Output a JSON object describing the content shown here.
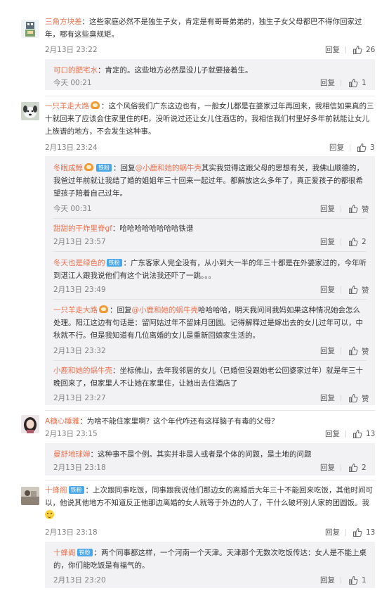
{
  "reply_label": "回复",
  "like_label_zero": "赞",
  "badge_label": "铁粉",
  "comments": [
    {
      "user": "三角方块差",
      "colon": "：",
      "text": "这些家庭必然不是独生子女，肯定是有哥哥弟弟的，独生子女父母都巴不得你回家过年，哪有这些臭规矩。",
      "time": "2月13日 23:22",
      "likes": "26"
    },
    {
      "user": "可口的肥宅水",
      "colon": "：",
      "text": "肯定的。这些地方必然是没儿子就要接着生。",
      "time": "今天 00:21",
      "likes": "1"
    },
    {
      "user": "一只羊走大路",
      "colon": "：",
      "text": "这个风俗我们广东这边也有，一般女儿都是在婆家过年再回来，我相信如果真的三十就回来了应该会住家里住的吧，没听说过还让女儿住酒店的，我相信我们村里好多年前就能让女儿上族谱的地方，不会发生这种事。",
      "time": "2月13日 23:24",
      "likes": "3"
    },
    {
      "user": "冬眠成鲸",
      "colon": "：",
      "reply_to": "回复",
      "mention": "@小鹿和她的蜗牛壳",
      "text": "其实我觉得这跟父母的思想有关，我佛山顺德的，我爸过年前就让我结了婚的姐姐年三十回来一起过年。都解放这么多年了，真正爱孩子的都很希望孩子陪着自己过年。",
      "time": "今天 00:31",
      "likes": "赞"
    },
    {
      "user": "甜甜的干炸里脊gf",
      "colon": "：",
      "text": "哈哈哈哈哈哈哈哈铁谱",
      "time": "2月13日 23:57",
      "likes": "2"
    },
    {
      "user": "冬天也是绿色的",
      "colon": "：",
      "text": "广东客家人完全没有，从小到大一半的年三十都是在外婆家过的，今年听到湛江人跟我说他们有这个说法我还吓了一跳。。。",
      "time": "2月13日 23:49",
      "likes": "赞"
    },
    {
      "user": "一只羊走大路",
      "colon": "：",
      "reply_to": "回复",
      "mention": "@小鹿和她的蜗牛壳",
      "text": "哈哈哈哈，明天我问问我妈如果这种情况她会怎么处理。阳江这边有句话是：留阿姑过年不留妹月团圆。记得解释过是嫁出去的女儿过年可以，中秋就不行。但是我知道有几位离婚的女儿是重新回娘家生活的。",
      "time": "2月13日 23:32",
      "likes": "赞"
    },
    {
      "user": "小鹿和她的蜗牛壳",
      "colon": "：",
      "text": "坐标佛山，去年我邻居的女儿（已婚但没跟她老公回婆家过年）就是年三十晚回来了，但家里人不让她在家里住，让她出去住酒店了",
      "time": "2月13日 23:27",
      "likes": "赞"
    },
    {
      "user": "A糖心睡雅",
      "colon": "：",
      "text": "为啥不能住家里啊？这个年代咋还有这样脑子有毒的父母？",
      "time": "2月13日 23:15",
      "likes": "13"
    },
    {
      "user": "曼舒地球婵",
      "colon": "：",
      "text": "这种事不是个例。其实并非是人或者是个体的问题，是土地的问题",
      "time": "2月13日 23:18",
      "likes": "2"
    },
    {
      "user": "十蜂阁",
      "colon": "：",
      "text": "上次跟同事吃饭，同事跟我说他们那边女的离婚后大年三十不能回来吃饭，其他时间可以，他说其他地方不知道反正他那边离婚的女人就等于外边的人了，干什么破坏别人家的团圆饭。我",
      "time": "2月13日 23:18",
      "likes": "13"
    },
    {
      "user": "十蜂阁",
      "colon": "：",
      "text": "两个同事都这样，一个河南一个天津。天津那个无数次吃饭传达：女人是不能上桌的，你们能吃饭是有福气的。",
      "time": "2月13日 23:20",
      "likes": "1"
    }
  ]
}
